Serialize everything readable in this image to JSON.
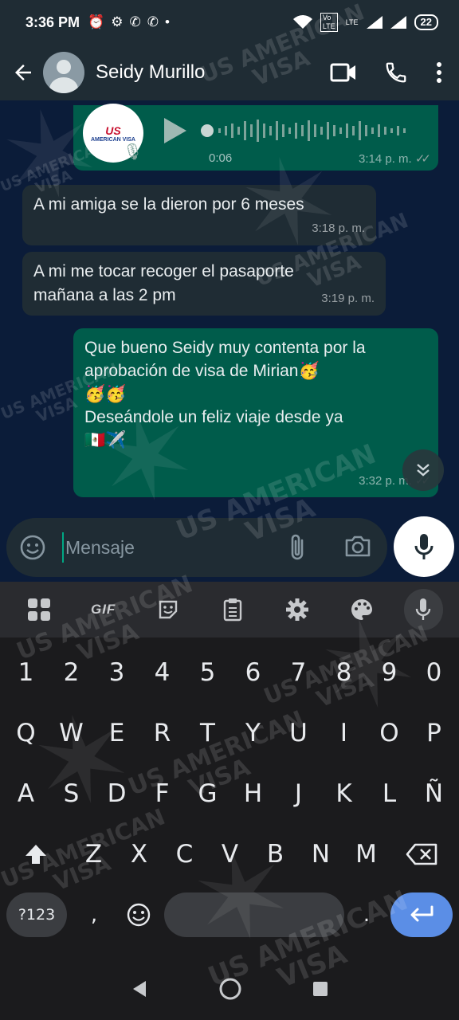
{
  "status_bar": {
    "time": "3:36 PM",
    "lte_label": "LTE",
    "battery": "22",
    "icons": [
      "alarm-icon",
      "gear-icon",
      "whatsapp-icon",
      "whatsapp-icon",
      "dot-icon"
    ]
  },
  "header": {
    "contact_name": "Seidy Murillo",
    "icons": [
      "back-arrow-icon",
      "video-call-icon",
      "phone-icon",
      "more-vertical-icon"
    ]
  },
  "voice_note": {
    "duration": "0:06",
    "time": "3:14 p. m.",
    "ticks": "✓✓",
    "logo_text": "US",
    "logo_sub": "AMERICAN VISA"
  },
  "messages": [
    {
      "direction": "in",
      "text": "A mi amiga se la dieron por 6 meses",
      "time": "3:18 p. m."
    },
    {
      "direction": "in",
      "text": "A mi me tocar recoger el pasaporte mañana a las 2 pm",
      "time": "3:19 p. m."
    },
    {
      "direction": "out",
      "text": "Que bueno Seidy muy contenta por la aprobación de visa de Mirian🥳\n🥳🥳\nDeseándole un feliz viaje desde ya\n🇲🇽✈️",
      "time": "3:32 p. m."
    }
  ],
  "composer": {
    "placeholder": "Mensaje"
  },
  "keyboard": {
    "toolbar": {
      "gif_label": "GIF"
    },
    "numbers": [
      "1",
      "2",
      "3",
      "4",
      "5",
      "6",
      "7",
      "8",
      "9",
      "0"
    ],
    "row1": [
      "Q",
      "W",
      "E",
      "R",
      "T",
      "Y",
      "U",
      "I",
      "O",
      "P"
    ],
    "row2": [
      "A",
      "S",
      "D",
      "F",
      "G",
      "H",
      "J",
      "K",
      "L",
      "Ñ"
    ],
    "row3": [
      "Z",
      "X",
      "C",
      "V",
      "B",
      "N",
      "M"
    ],
    "symbols_label": "?123",
    "comma_label": ",",
    "period_label": "."
  },
  "watermark": {
    "line1": "US AMERICAN",
    "line2": "VISA"
  },
  "colors": {
    "header_bg": "#1f2c34",
    "outgoing_bubble": "#005c4b",
    "incoming_bubble": "#1f2c34",
    "accent": "#00a884",
    "enter_key": "#5b8ee6"
  }
}
